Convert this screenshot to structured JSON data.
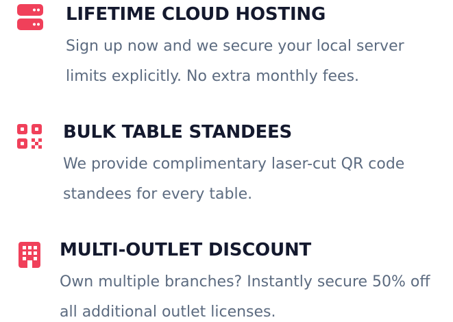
{
  "features": [
    {
      "icon": "server-icon",
      "title": "LIFETIME CLOUD HOSTING",
      "description": "Sign up now and we secure your local server limits explicitly. No extra monthly fees."
    },
    {
      "icon": "qr-code-icon",
      "title": "BULK TABLE STANDEES",
      "description": "We provide complimentary laser-cut QR code standees for every table."
    },
    {
      "icon": "building-icon",
      "title": "MULTI-OUTLET DISCOUNT",
      "description": "Own multiple branches? Instantly secure 50% off all additional outlet licenses."
    }
  ],
  "colors": {
    "accent": "#f0405a",
    "heading": "#14192e",
    "body_text": "#5c6b80",
    "background": "#ffffff"
  }
}
